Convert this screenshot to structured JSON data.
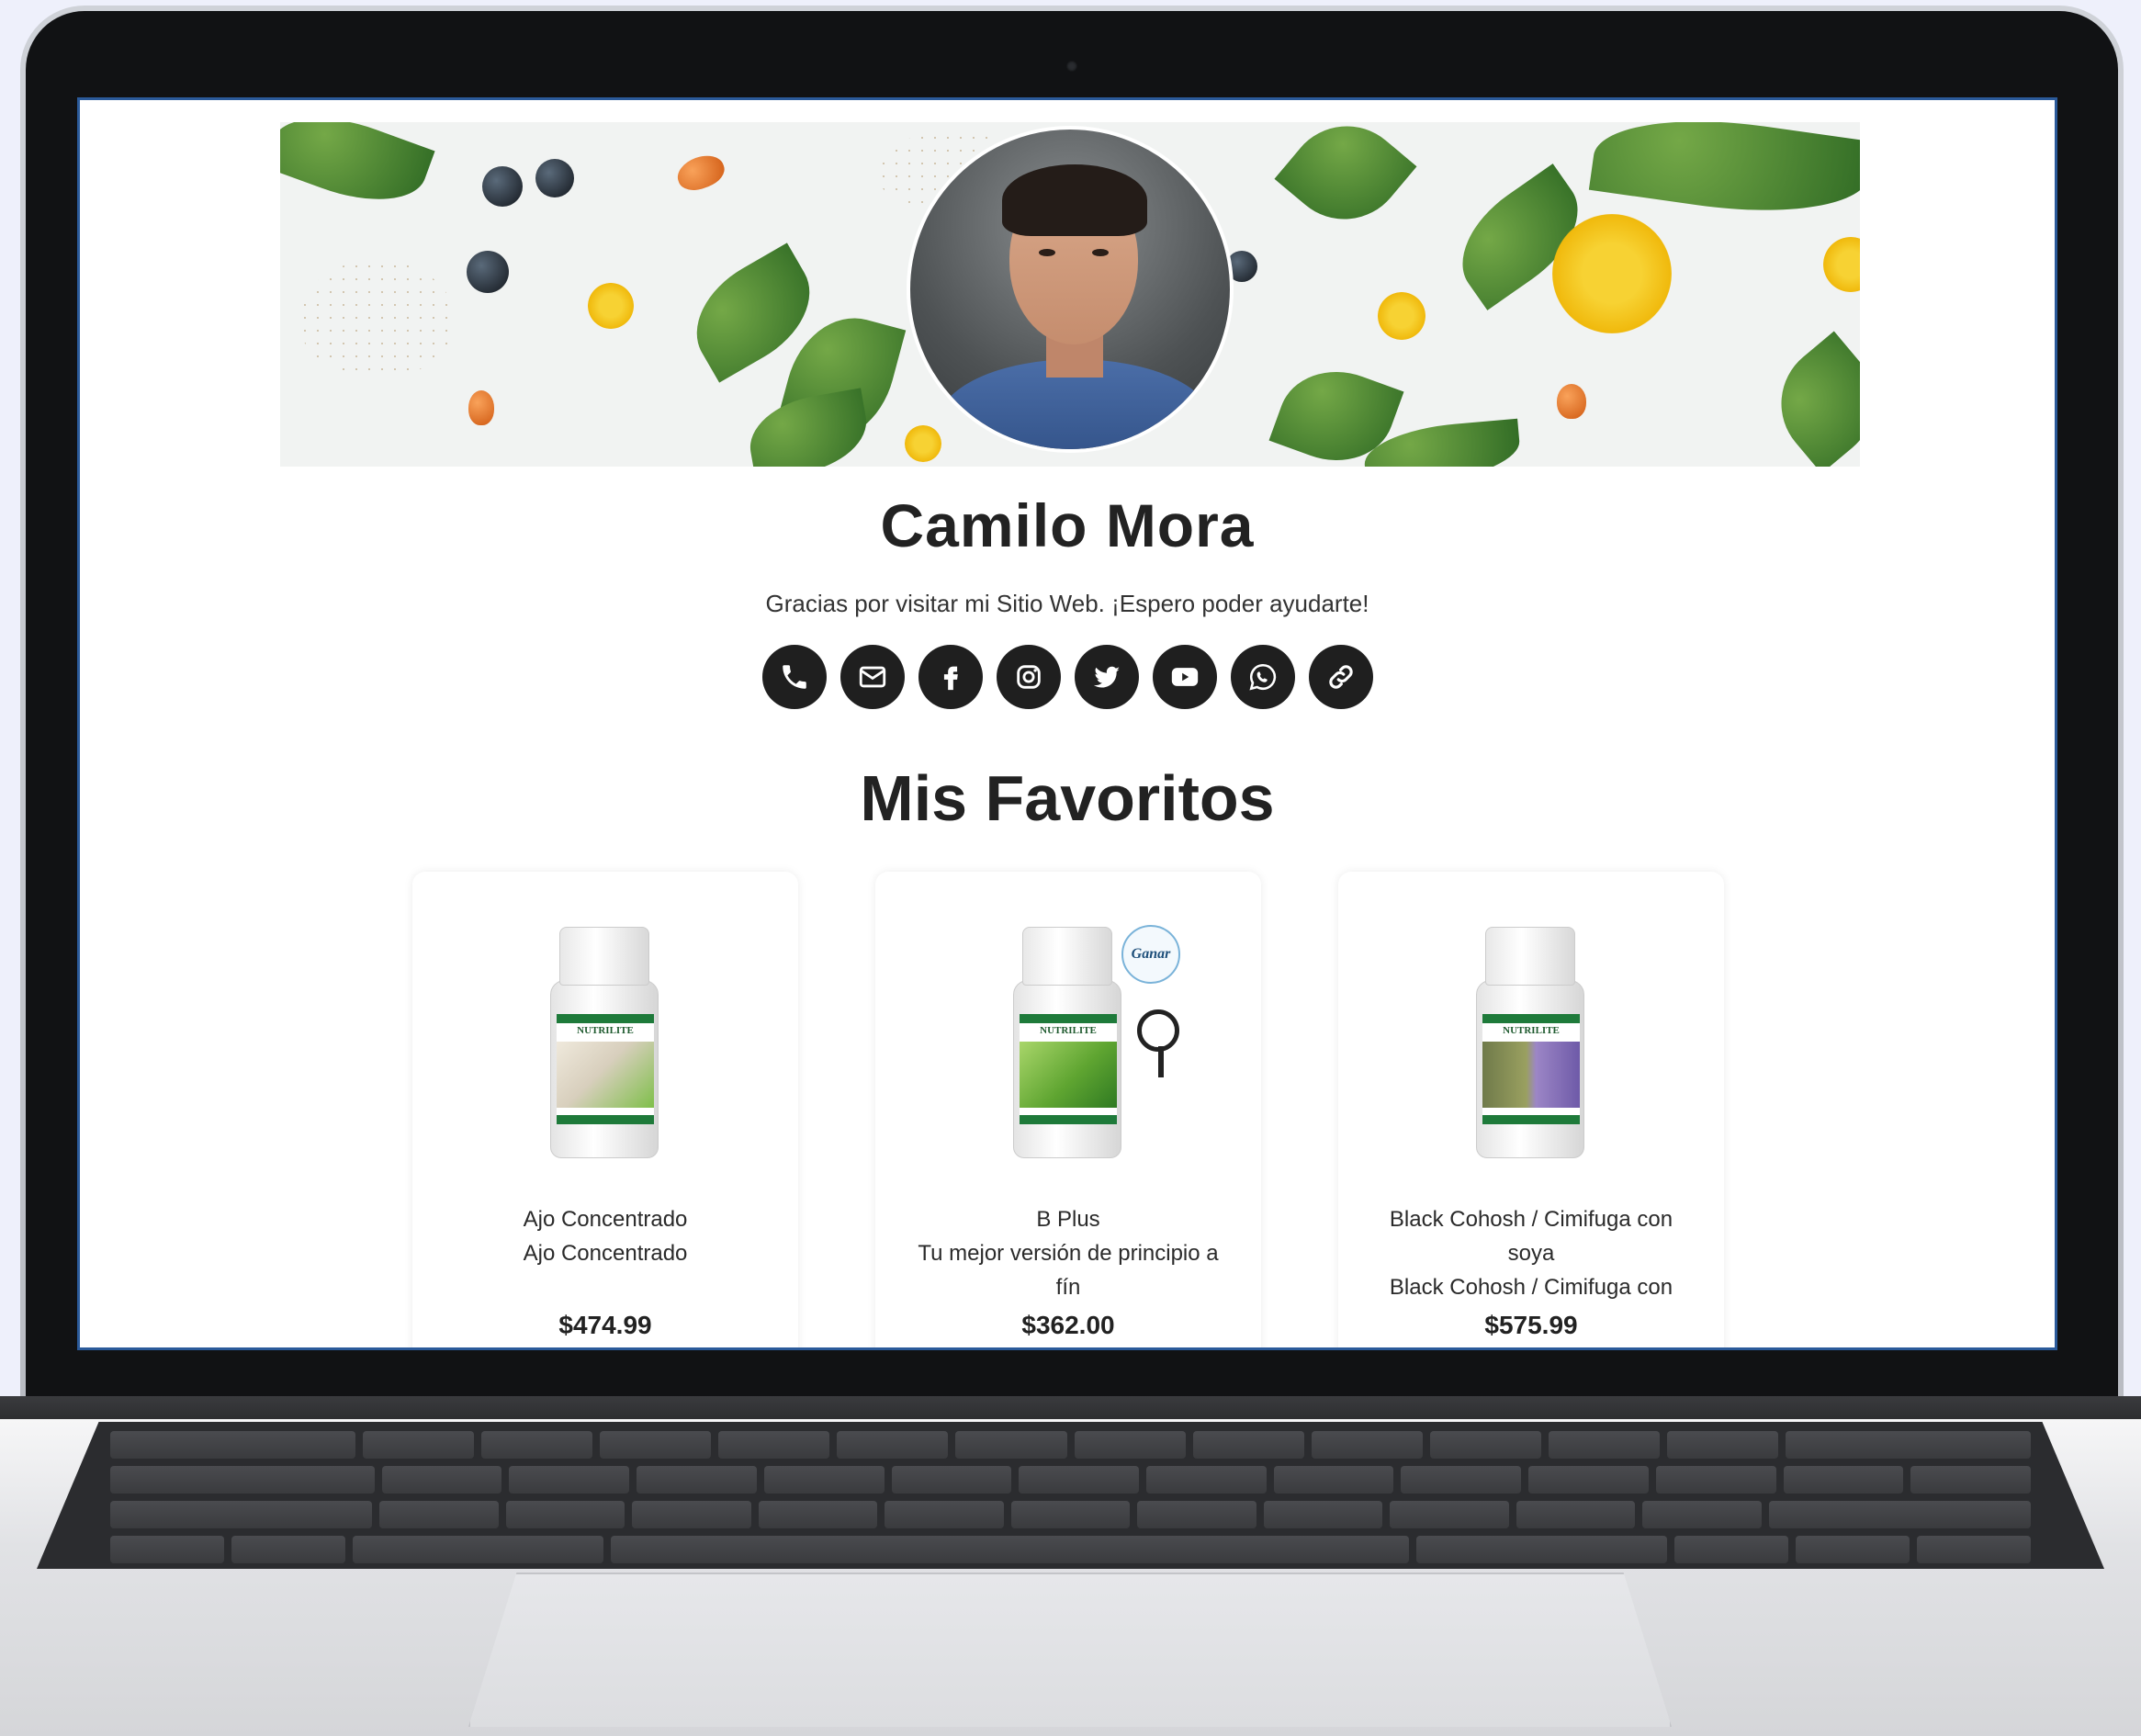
{
  "profile": {
    "name": "Camilo Mora",
    "greeting": "Gracias por visitar mi Sitio Web. ¡Espero poder ayudarte!"
  },
  "socials": [
    {
      "icon": "phone-icon"
    },
    {
      "icon": "mail-icon"
    },
    {
      "icon": "facebook-icon"
    },
    {
      "icon": "instagram-icon"
    },
    {
      "icon": "twitter-icon"
    },
    {
      "icon": "youtube-icon"
    },
    {
      "icon": "whatsapp-icon"
    },
    {
      "icon": "link-icon"
    }
  ],
  "favorites": {
    "title": "Mis Favoritos",
    "products": [
      {
        "name": "Ajo Concentrado",
        "description": "Ajo Concentrado",
        "price": "$474.99",
        "brand": "NUTRILITE",
        "color": "#c9d8a8"
      },
      {
        "name": "B Plus",
        "description": "Tu mejor versión de principio a fín",
        "price": "$362.00",
        "brand": "NUTRILITE",
        "color": "#6fae3e",
        "badge": "Ganar"
      },
      {
        "name": "Black Cohosh / Cimifuga con soya",
        "description": "Black Cohosh / Cimifuga con",
        "price": "$575.99",
        "brand": "NUTRILITE",
        "color": "#8a7fb8"
      }
    ]
  },
  "colors": {
    "accent": "#1f1f1f",
    "text": "#222222",
    "screen_border": "#2b5a9a"
  }
}
